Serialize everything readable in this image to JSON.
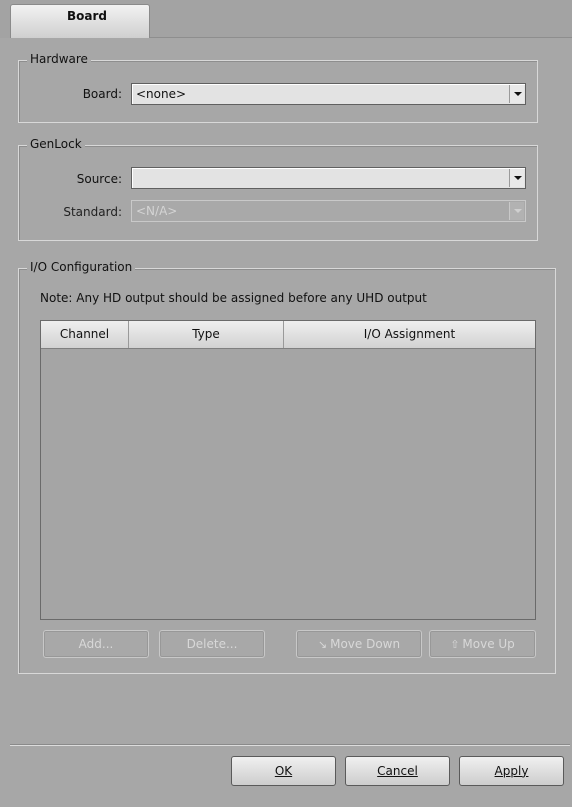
{
  "tabs": [
    {
      "label": "Board",
      "active": true
    }
  ],
  "hardware": {
    "legend": "Hardware",
    "board_label": "Board:",
    "board_value": "<none>"
  },
  "genlock": {
    "legend": "GenLock",
    "source_label": "Source:",
    "source_value": "",
    "standard_label": "Standard:",
    "standard_value": "<N/A>"
  },
  "io": {
    "legend": "I/O Configuration",
    "note": "Note: Any HD output should be assigned before any UHD output",
    "columns": [
      "Channel",
      "Type",
      "I/O Assignment"
    ],
    "rows": [],
    "buttons": {
      "add": "Add...",
      "delete": "Delete...",
      "move_down": "Move Down",
      "move_up": "Move Up"
    }
  },
  "footer": {
    "ok": "OK",
    "cancel": "Cancel",
    "apply": "Apply"
  },
  "icons": {
    "move_down": "down-arrow-icon",
    "move_up": "up-arrow-icon"
  }
}
